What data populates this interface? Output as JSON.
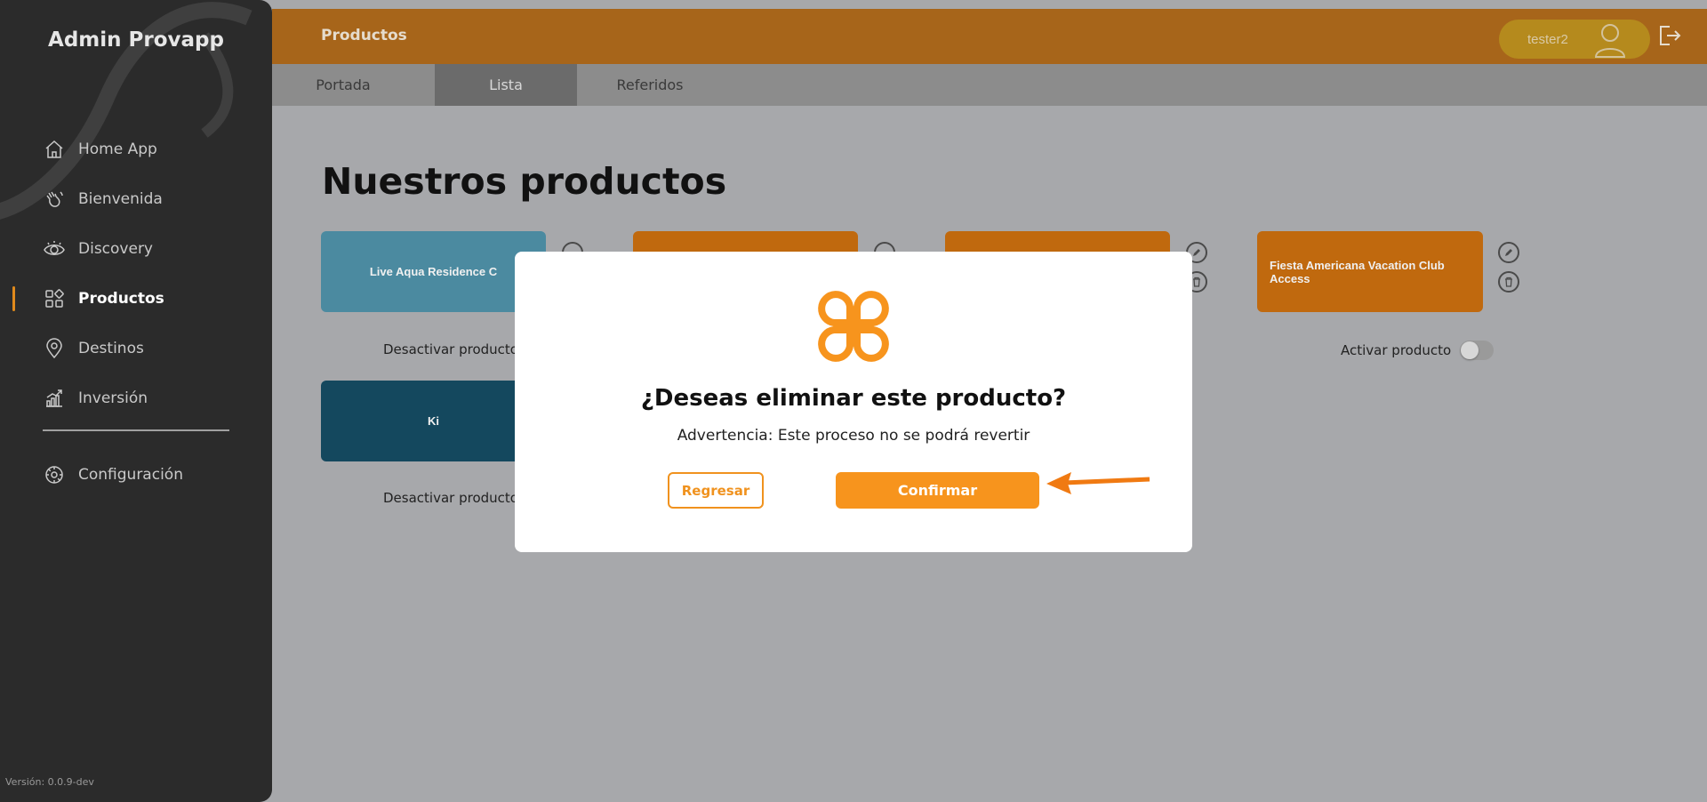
{
  "sidebar": {
    "brand": "Admin Provapp",
    "items": [
      {
        "label": "Home App",
        "icon": "home-icon"
      },
      {
        "label": "Bienvenida",
        "icon": "waving-hand-icon"
      },
      {
        "label": "Discovery",
        "icon": "eye-icon"
      },
      {
        "label": "Productos",
        "icon": "grid-icon",
        "active": true
      },
      {
        "label": "Destinos",
        "icon": "map-pin-icon"
      },
      {
        "label": "Inversión",
        "icon": "growth-chart-icon"
      }
    ],
    "config_label": "Configuración",
    "version": "Versión: 0.0.9-dev"
  },
  "header": {
    "title": "Productos",
    "username": "tester2"
  },
  "tabs": [
    {
      "label": "Portada"
    },
    {
      "label": "Lista",
      "active": true
    },
    {
      "label": "Referidos"
    }
  ],
  "main": {
    "heading": "Nuestros productos",
    "cards": [
      {
        "title": "Live Aqua Residence C",
        "color": "#4b8aa0"
      },
      {
        "title": "",
        "color": "#c0690e"
      },
      {
        "title": "",
        "color": "#c0690e"
      },
      {
        "title": "Fiesta Americana Vacation Club Access",
        "color": "#c0690e"
      },
      {
        "title": "Ki",
        "color": "#14485e"
      }
    ],
    "toggles": [
      {
        "label": "Desactivar producto",
        "on": true
      },
      {
        "label": "Activar producto",
        "on": false
      },
      {
        "label": "Desactivar producto",
        "on": true
      }
    ]
  },
  "modal": {
    "title": "¿Deseas eliminar este producto?",
    "warning": "Advertencia: Este proceso no se podrá revertir",
    "back_label": "Regresar",
    "confirm_label": "Confirmar"
  },
  "colors": {
    "accent": "#f7941d",
    "sidebar_bg": "#2b2b2b",
    "topbar_bg": "#a7651a"
  }
}
